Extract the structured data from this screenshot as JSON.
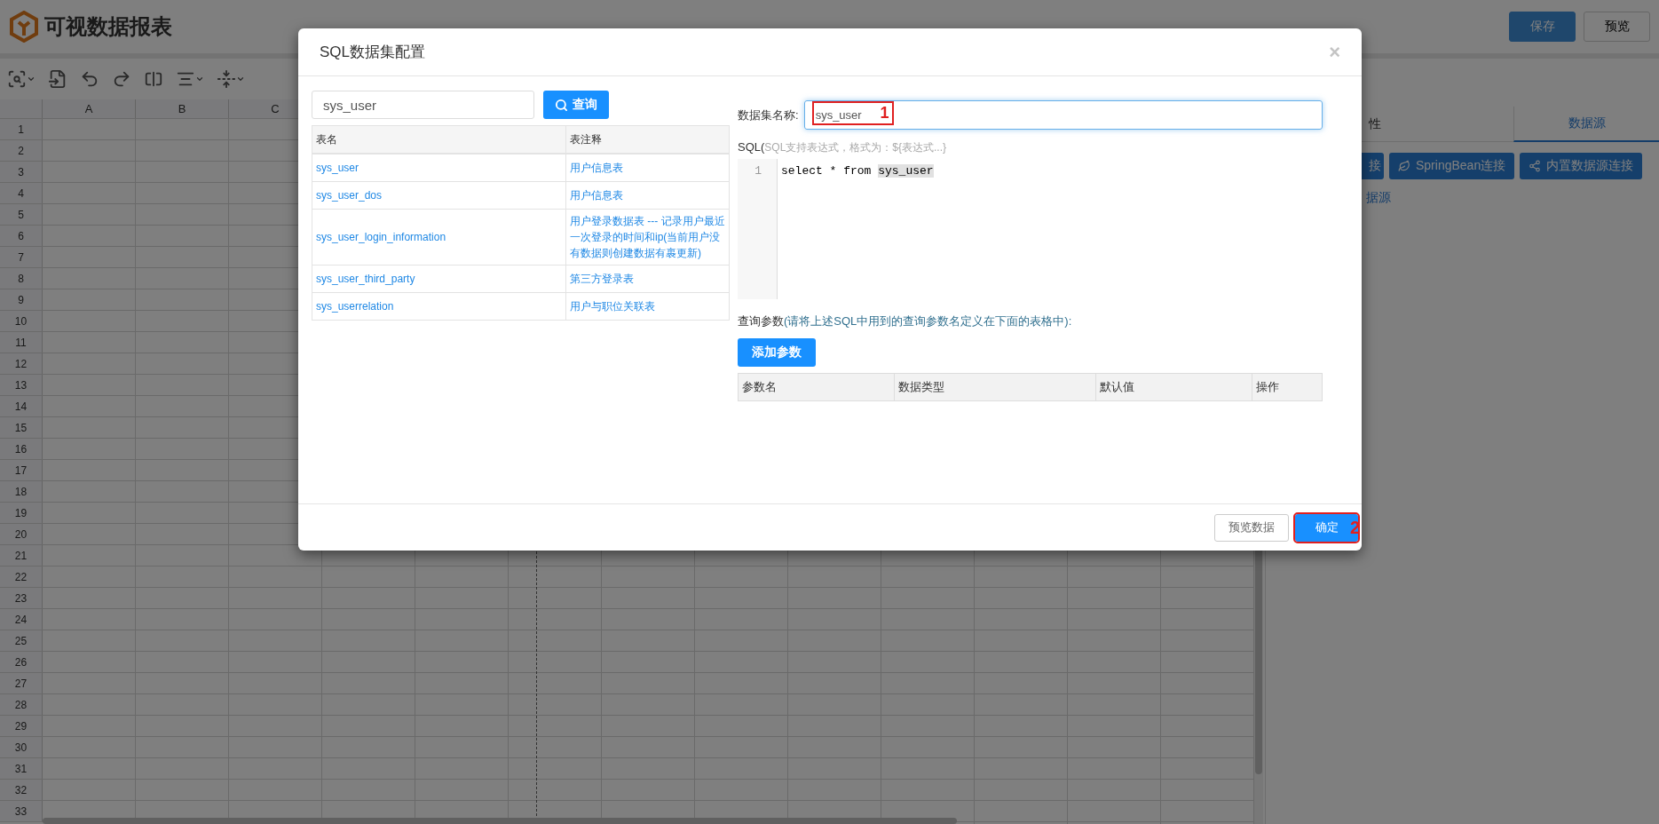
{
  "app": {
    "title": "可视数据报表"
  },
  "header_buttons": [
    {
      "label": "保存",
      "kind": "primary"
    },
    {
      "label": "预览",
      "kind": "default"
    }
  ],
  "spreadsheet": {
    "columns": [
      "A",
      "B",
      "C"
    ],
    "rows": [
      "1",
      "2",
      "3",
      "4",
      "5",
      "6",
      "7",
      "8",
      "9",
      "10",
      "11",
      "12",
      "13",
      "14",
      "15",
      "16",
      "17",
      "18",
      "19",
      "20",
      "21",
      "22",
      "23",
      "24",
      "25",
      "26",
      "27",
      "28",
      "29",
      "30",
      "31",
      "32",
      "33"
    ]
  },
  "side_panel": {
    "tabs": [
      {
        "label": "性",
        "selected": false
      },
      {
        "label": "数据源",
        "selected": true
      }
    ],
    "buttons": [
      {
        "label": "接",
        "kind": "plain"
      },
      {
        "label": "SpringBean连接",
        "kind": "spring"
      },
      {
        "label": "内置数据源连接",
        "kind": "share"
      }
    ],
    "link": "据源"
  },
  "dialog": {
    "title": "SQL数据集配置",
    "close": "×",
    "search": {
      "value": "sys_user",
      "button": "查询"
    },
    "tables": {
      "columns": [
        "表名",
        "表注释"
      ],
      "rows": [
        {
          "name": "sys_user",
          "comment": "用户信息表"
        },
        {
          "name": "sys_user_dos",
          "comment": "用户信息表"
        },
        {
          "name": "sys_user_login_information",
          "comment": "用户登录数据表 --- 记录用户最近一次登录的时间和ip(当前用户没有数据则创建数据有裹更新)"
        },
        {
          "name": "sys_user_third_party",
          "comment": "第三方登录表"
        },
        {
          "name": "sys_userrelation",
          "comment": "用户与职位关联表"
        }
      ]
    },
    "name_field": {
      "label": "数据集名称:",
      "value": "sys_user",
      "marker": "1"
    },
    "sql": {
      "label": "SQL(",
      "hint": "SQL支持表达式，格式为：${表达式...}",
      "lines": [
        {
          "number": "1",
          "before": "select * from ",
          "match": "sys_user"
        }
      ]
    },
    "params": {
      "label": "查询参数",
      "hint": "(请将上述SQL中用到的查询参数名定义在下面的表格中):",
      "add_button": "添加参数",
      "columns": [
        "参数名",
        "数据类型",
        "默认值",
        "操作"
      ]
    },
    "footer_buttons": [
      {
        "label": "预览数据",
        "kind": "default"
      },
      {
        "label": "确定",
        "kind": "primary",
        "marker": "2"
      }
    ]
  }
}
